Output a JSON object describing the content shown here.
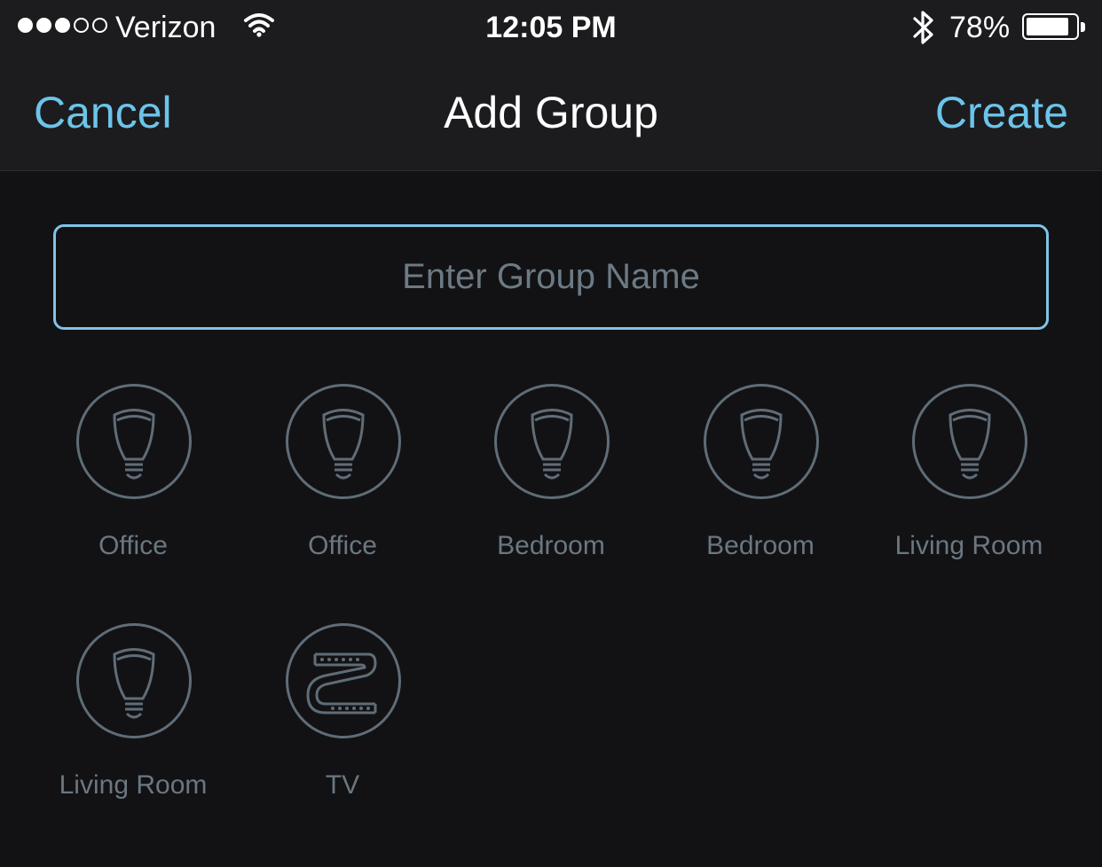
{
  "status_bar": {
    "carrier": "Verizon",
    "signal_bars": 3,
    "signal_total": 5,
    "time": "12:05 PM",
    "battery_percent": "78%",
    "bluetooth_icon": "bluetooth-icon",
    "wifi_icon": "wifi-icon"
  },
  "nav": {
    "cancel_label": "Cancel",
    "title": "Add Group",
    "create_label": "Create"
  },
  "group_name": {
    "value": "",
    "placeholder": "Enter Group Name"
  },
  "lights": [
    {
      "name": "Office",
      "icon": "bulb-icon"
    },
    {
      "name": "Office",
      "icon": "bulb-icon"
    },
    {
      "name": "Bedroom",
      "icon": "bulb-icon"
    },
    {
      "name": "Bedroom",
      "icon": "bulb-icon"
    },
    {
      "name": "Living Room",
      "icon": "bulb-icon"
    },
    {
      "name": "Living Room",
      "icon": "bulb-icon"
    },
    {
      "name": "TV",
      "icon": "lightstrip-icon"
    }
  ],
  "colors": {
    "accent": "#6cc4ea",
    "background": "#121215",
    "nav_background": "#1c1c1f",
    "icon_stroke": "#5f6d77",
    "label": "#6b7780"
  }
}
